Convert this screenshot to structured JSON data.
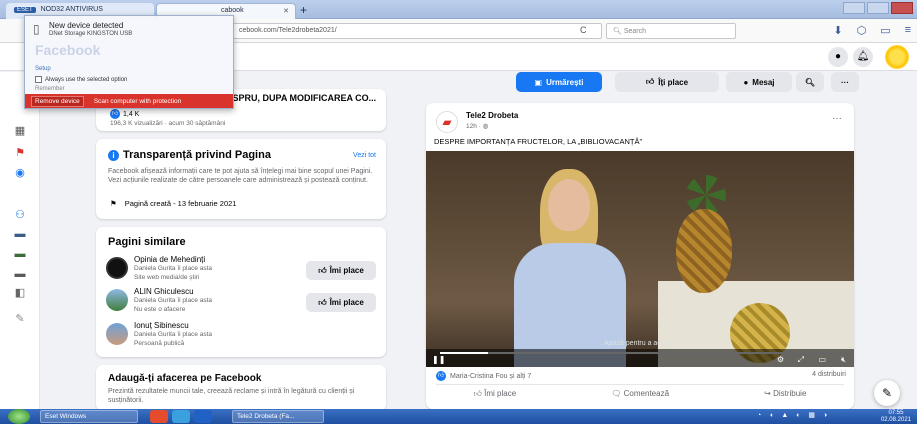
{
  "browser": {
    "tabs": [
      {
        "badge": "ESET",
        "label": "NOD32 ANTIVIRUS"
      },
      {
        "label": "cabook"
      }
    ],
    "url": "cebook.com/Tele2drobeta2021/",
    "search_placeholder": "Search"
  },
  "popup": {
    "title": "New device detected",
    "device": "DNet Storage KINGSTON USB",
    "setup": "Setup",
    "option": "Always use the selected option",
    "remember": "Remember",
    "faded_text": "Facebook",
    "red_button": "Remove device",
    "red_text": "Scan computer with protection"
  },
  "page_actions": {
    "follow": "Urmărești",
    "like": "Îți place",
    "message": "Mesaj",
    "more": "···"
  },
  "top_post": {
    "title": "ASPRU, DUPA MODIFICAREA CO...",
    "reactions": "1,4 K",
    "meta": "196,3 K vizualizări · acum 30 săptămâni"
  },
  "transparency": {
    "title": "Transparență privind Pagina",
    "see_all": "Vezi tot",
    "body": "Facebook afișează informații care te pot ajuta să înțelegi mai bine scopul unei Pagini. Vezi acțiunile realizate de către persoanele care administrează și postează conținut.",
    "created": "Pagină creată - 13 februarie 2021"
  },
  "similar": {
    "title": "Pagini similare",
    "like_label": "Îmi place",
    "items": [
      {
        "name": "Opinia de Mehedinți",
        "friends": "Daniela Gurita îi place asta",
        "category": "Site web media/de știri"
      },
      {
        "name": "ALIN Ghiculescu",
        "friends": "Daniela Gurita îi place asta",
        "category": "Nu este o afacere"
      },
      {
        "name": "Ionuț Sibinescu",
        "friends": "Daniela Gurita îi place asta",
        "category": "Persoană publică"
      }
    ]
  },
  "business": {
    "title": "Adaugă-ți afacerea pe Facebook",
    "body": "Prezintă rezultatele muncii tale, creează reclame și intră în legătură cu clienții și susținătorii."
  },
  "post": {
    "author": "Tele2 Drobeta",
    "time": "12h",
    "text": "DESPRE IMPORTANȚA FRUCTELOR, LA „BIBLIOVACANȚĂ”",
    "video_caption": "Apasă pentru a activa",
    "video_progress": 0.12,
    "reactions": "Maria-Cristina Fou și alți 7",
    "shares": "4 distribuiri",
    "actions": [
      "Îmi place",
      "Comentează",
      "Distribuie"
    ]
  },
  "taskbar": {
    "items": [
      "Eset Windows",
      "Tele2 Drobeta (Fa..."
    ],
    "time": "07:55",
    "date": "02.08.2021"
  },
  "colors": {
    "fb_blue": "#1877f2",
    "popup_red": "#d9342b",
    "taskbar": "#2a5cb0"
  }
}
